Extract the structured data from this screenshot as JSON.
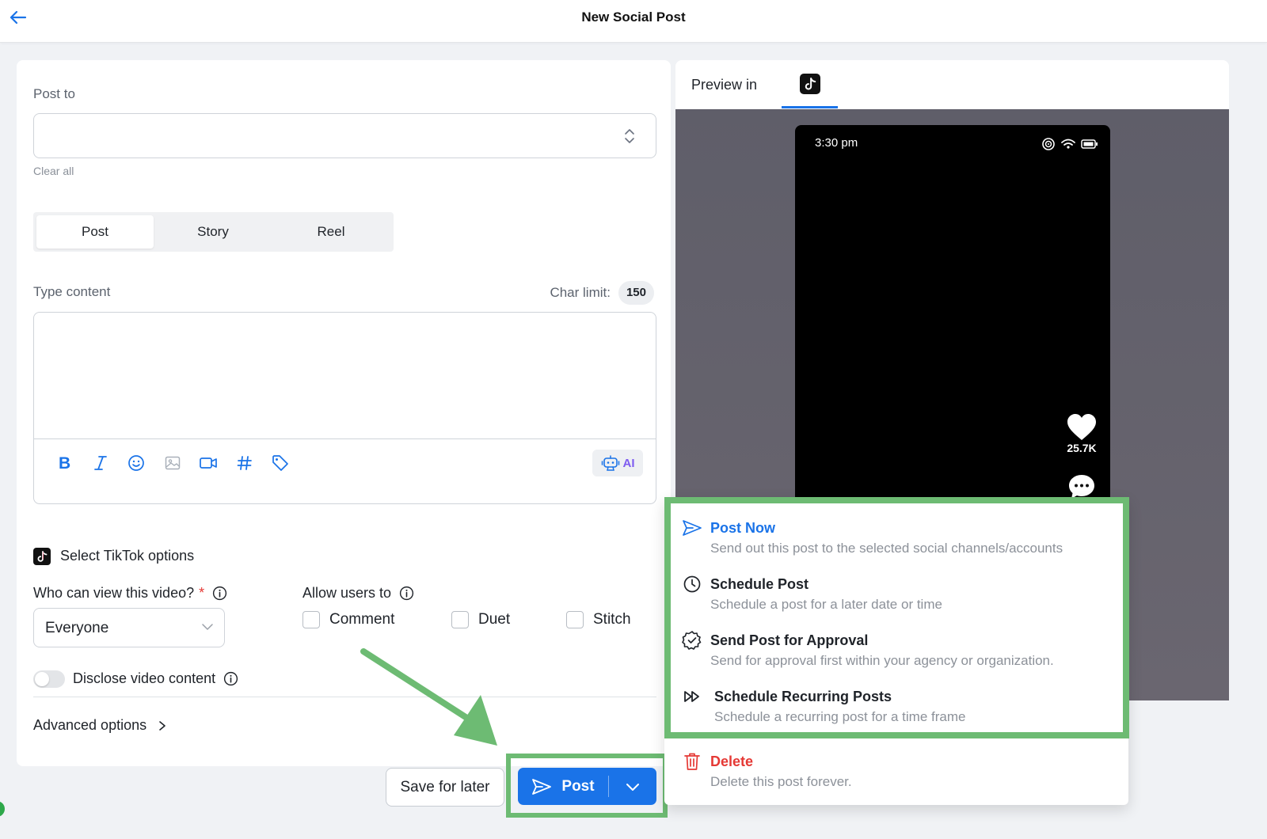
{
  "header": {
    "title": "New Social Post"
  },
  "form": {
    "post_to_label": "Post to",
    "clear_all": "Clear all",
    "tabs": [
      "Post",
      "Story",
      "Reel"
    ],
    "content_label": "Type content",
    "char_limit_label": "Char limit:",
    "char_limit_value": "150",
    "ai_label": "AI",
    "tiktok_options_label": "Select TikTok options",
    "who_can_view_label": "Who can view this video?",
    "required_mark": "*",
    "who_can_view_value": "Everyone",
    "allow_users_label": "Allow users to",
    "allow_options": [
      "Comment",
      "Duet",
      "Stitch"
    ],
    "disclose_label": "Disclose video content",
    "advanced_label": "Advanced options"
  },
  "actions": {
    "save_later": "Save for later",
    "post": "Post"
  },
  "preview": {
    "label": "Preview in",
    "phone_time": "3:30 pm",
    "likes": "25.7K"
  },
  "menu": {
    "items": [
      {
        "title": "Post Now",
        "desc": "Send out this post to the selected social channels/accounts",
        "icon": "send-icon"
      },
      {
        "title": "Schedule Post",
        "desc": "Schedule a post for a later date or time",
        "icon": "clock-icon"
      },
      {
        "title": "Send Post for Approval",
        "desc": "Send for approval first within your agency or organization.",
        "icon": "badge-check-icon"
      },
      {
        "title": "Schedule Recurring Posts",
        "desc": "Schedule a recurring post for a time frame",
        "icon": "fast-forward-icon"
      },
      {
        "title": "Delete",
        "desc": "Delete this post forever.",
        "icon": "trash-icon"
      }
    ]
  },
  "colors": {
    "primary": "#1a73e8",
    "highlight": "#6dbb73",
    "danger": "#e53935",
    "ai_accent": "#7e5cf0"
  }
}
